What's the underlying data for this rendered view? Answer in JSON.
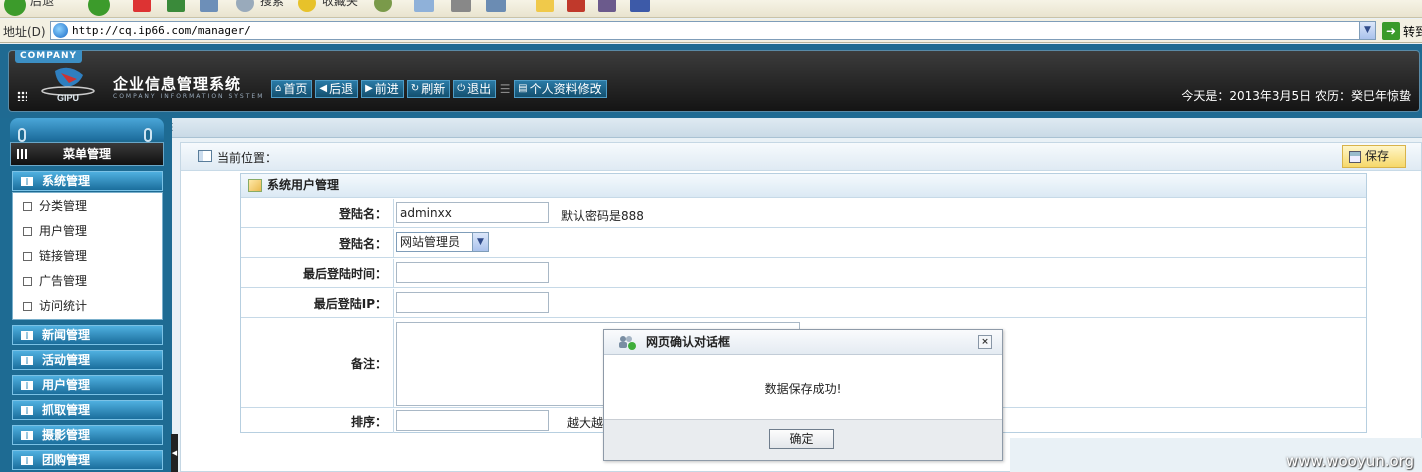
{
  "browser": {
    "toolbar": {
      "back_label": "后退",
      "search_label": "搜索",
      "favorites_label": "收藏夹"
    },
    "address_label": "地址(D)",
    "url": "http://cq.ip66.com/manager/",
    "go_label": "转到"
  },
  "header": {
    "company_tag": "COMPANY",
    "logo_text": "GIPU",
    "title": "企业信息管理系统",
    "subtitle": "COMPANY INFORMATION SYSTEM",
    "nav": [
      {
        "label": "首页",
        "icon": "home-icon"
      },
      {
        "label": "后退",
        "icon": "arrow-left-icon"
      },
      {
        "label": "前进",
        "icon": "arrow-right-icon"
      },
      {
        "label": "刷新",
        "icon": "refresh-icon"
      },
      {
        "label": "退出",
        "icon": "power-icon"
      },
      {
        "label": "个人资料修改",
        "icon": "profile-icon"
      }
    ],
    "today": "今天是：2013年3月5日 农历：癸巳年惊蛰"
  },
  "sidebar": {
    "title": "菜单管理",
    "groups": [
      {
        "label": "系统管理",
        "items": [
          "分类管理",
          "用户管理",
          "链接管理",
          "广告管理",
          "访问统计"
        ]
      },
      {
        "label": "新闻管理"
      },
      {
        "label": "活动管理"
      },
      {
        "label": "用户管理"
      },
      {
        "label": "抓取管理"
      },
      {
        "label": "摄影管理"
      },
      {
        "label": "团购管理"
      }
    ]
  },
  "content": {
    "location_label": "当前位置：",
    "save_label": "保存",
    "form_title": "系统用户管理",
    "rows": [
      {
        "label": "登陆名：",
        "value": "adminxx",
        "hint": "默认密码是888"
      },
      {
        "label": "登陆名：",
        "select_value": "网站管理员"
      },
      {
        "label": "最后登陆时间：",
        "value": ""
      },
      {
        "label": "最后登陆IP：",
        "value": ""
      },
      {
        "label": "备注：",
        "value": ""
      },
      {
        "label": "排序：",
        "value": "",
        "hint": "越大越"
      }
    ]
  },
  "dialog": {
    "title": "网页确认对话框",
    "message": "数据保存成功!",
    "ok_label": "确定",
    "close_symbol": "×"
  },
  "watermark": "www.wooyun.org",
  "colors": {
    "header_bg": "#1f6a92",
    "header_dark": "#141414",
    "save_button": "#f6d86a"
  }
}
